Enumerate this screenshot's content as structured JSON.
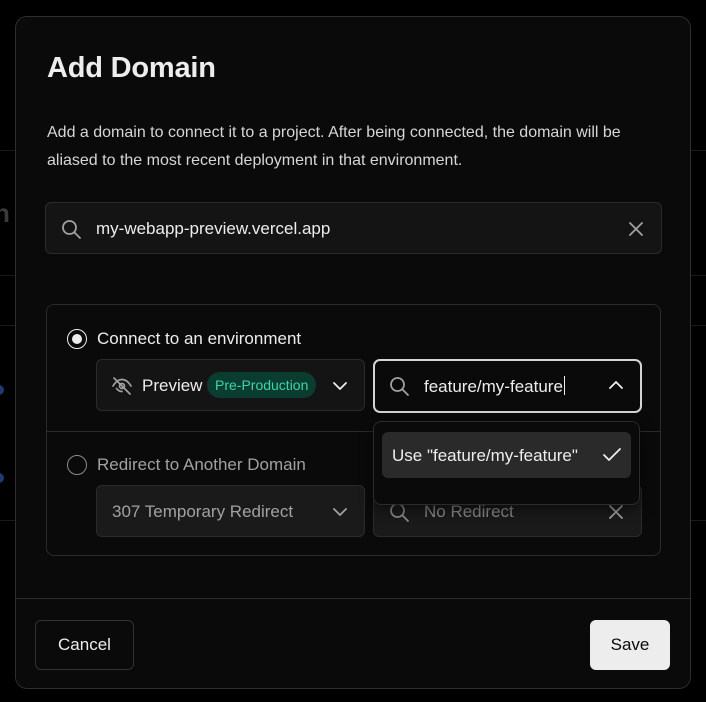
{
  "modal": {
    "title": "Add Domain",
    "description": "Add a domain to connect it to a project. After being connected, the domain will be aliased to the most recent deployment in that environment."
  },
  "domain_input": {
    "value": "my-webapp-preview.vercel.app",
    "icon": "search-icon",
    "clear_icon": "close-icon"
  },
  "connect_env": {
    "label": "Connect to an environment",
    "selected": true,
    "environment_select": {
      "value": "Preview",
      "badge": "Pre-Production",
      "icon": "eye-icon"
    },
    "branch_input": {
      "value": "feature/my-feature"
    },
    "dropdown": {
      "option_label": "Use \"feature/my-feature\""
    }
  },
  "redirect": {
    "label": "Redirect to Another Domain",
    "selected": false,
    "type_select": {
      "value": "307 Temporary Redirect"
    },
    "target_input": {
      "placeholder": "No Redirect"
    }
  },
  "footer": {
    "cancel_label": "Cancel",
    "save_label": "Save"
  },
  "colors": {
    "accent_badge_bg": "#0a3d30",
    "accent_badge_text": "#3fd4a3",
    "modal_bg": "#0a0a0a",
    "border": "#2b2b2b"
  }
}
